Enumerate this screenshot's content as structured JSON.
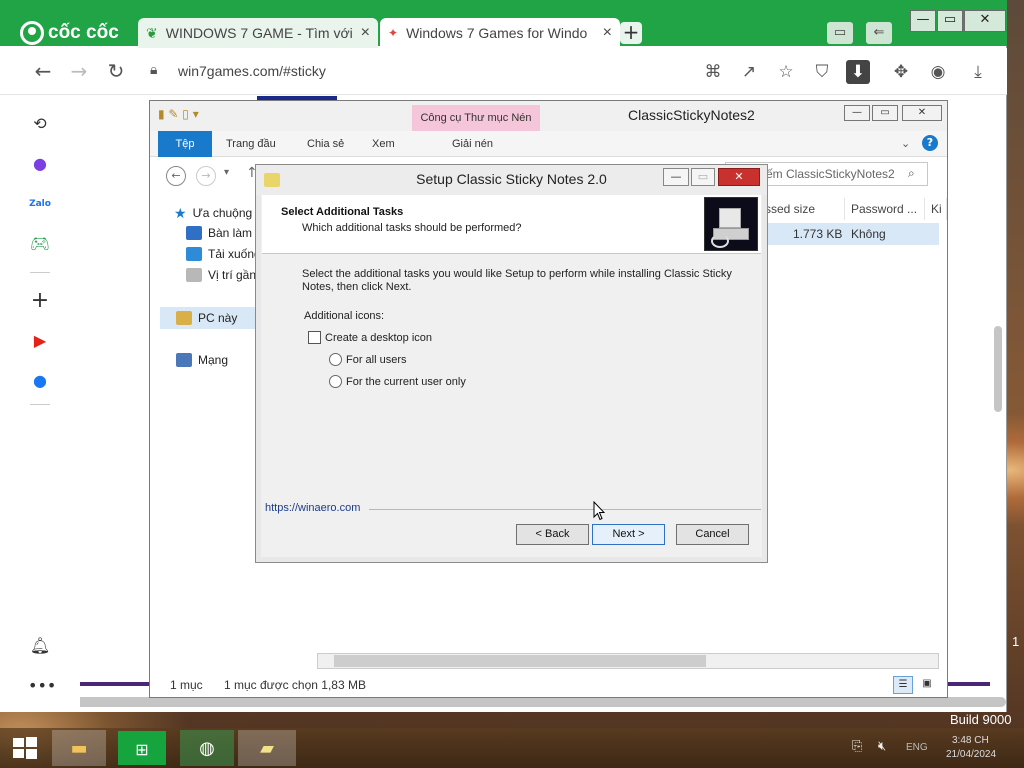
{
  "browser": {
    "brand": "cốc cốc",
    "tabs": [
      {
        "title": "WINDOWS 7 GAME - Tìm với",
        "close": "×"
      },
      {
        "title": "Windows 7 Games for Windo",
        "close": "×"
      }
    ],
    "new_tab": "+",
    "url": "win7games.com/#sticky",
    "window_buttons": {
      "minimize": "—",
      "maximize": "▭",
      "close": "✕"
    }
  },
  "explorer": {
    "title": "ClassicStickyNotes2",
    "context_tab": "Công cụ Thư mục Nén",
    "ribbon_tabs": [
      "Tệp",
      "Trang đầu",
      "Chia sẻ",
      "Xem",
      "Giải nén"
    ],
    "search_placeholder": "ếm ClassicStickyNotes2",
    "nav": {
      "quick_access": "Ưa chuộng",
      "desktop": "Bàn làm v",
      "downloads": "Tải xuống",
      "recent": "Vị trí gần",
      "this_pc": "PC này",
      "network": "Mạng"
    },
    "columns": [
      "ssed size",
      "Password ...",
      "Ki"
    ],
    "file_row": {
      "size": "1.773 KB",
      "password": "Không"
    },
    "status": {
      "count": "1 mục",
      "selected": "1 mục được chọn  1,83 MB"
    }
  },
  "dialog": {
    "title": "Setup Classic Sticky Notes 2.0",
    "header_title": "Select Additional Tasks",
    "header_subtitle": "Which additional tasks should be performed?",
    "body": "Select the additional tasks you would like Setup to perform while installing Classic Sticky Notes, then click Next.",
    "group_label": "Additional icons:",
    "checkbox_label": "Create a desktop icon",
    "checkbox_checked": false,
    "radio_all": "For all users",
    "radio_current": "For the current user only",
    "link": "https://winaero.com",
    "buttons": {
      "back": "< Back",
      "next": "Next >",
      "cancel": "Cancel"
    }
  },
  "taskbar": {
    "lang": "ENG",
    "time": "3:48 CH",
    "date": "21/04/2024",
    "build": "Build 9000",
    "desktop_fragment": "1"
  }
}
